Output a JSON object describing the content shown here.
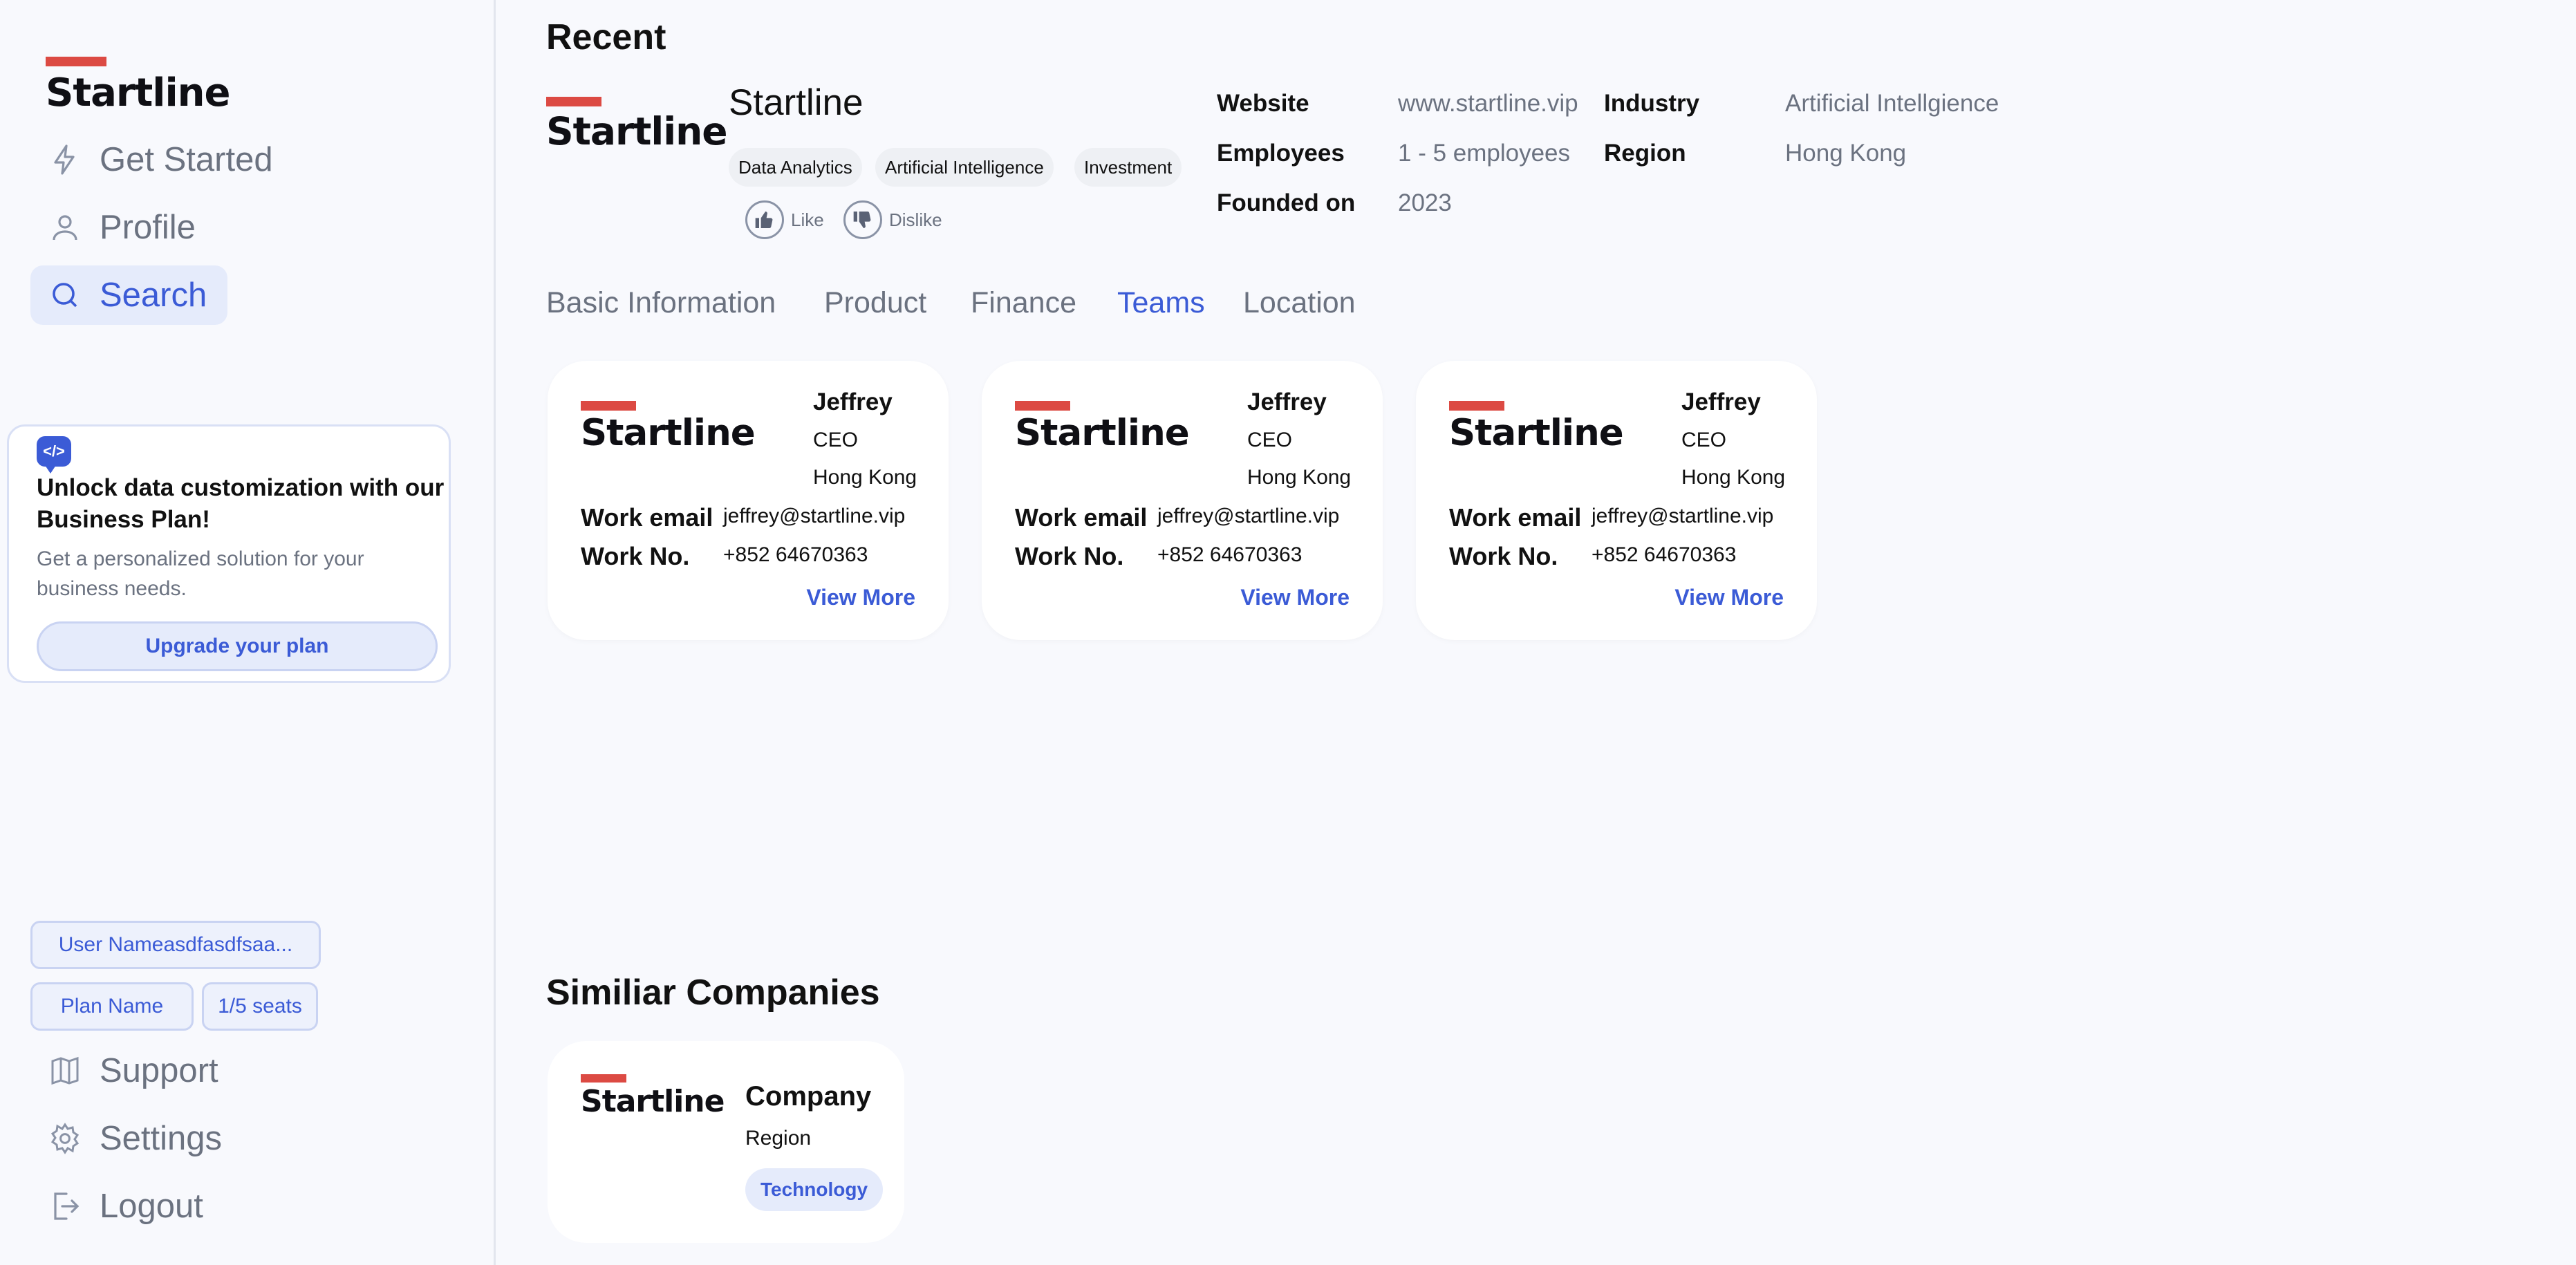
{
  "sidebar": {
    "brand": "Startline",
    "nav": [
      {
        "label": "Get Started",
        "icon": "lightning-icon"
      },
      {
        "label": "Profile",
        "icon": "person-icon"
      },
      {
        "label": "Search",
        "icon": "search-icon"
      }
    ],
    "promo": {
      "title": "Unlock data customization with our Business Plan!",
      "body": "Get a personalized solution for your business needs.",
      "button": "Upgrade your plan"
    },
    "user_name": "User Nameasdfasdfsaa...",
    "plan_name": "Plan Name",
    "seats": "1/5 seats",
    "bottom_nav": [
      {
        "label": "Support",
        "icon": "book-icon"
      },
      {
        "label": "Settings",
        "icon": "gear-icon"
      },
      {
        "label": "Logout",
        "icon": "logout-icon"
      }
    ]
  },
  "recent": {
    "heading": "Recent",
    "company": {
      "logo": "Startline",
      "name": "Startline",
      "tags": [
        "Data Analytics",
        "Artificial Intelligence",
        "Investment"
      ],
      "like": "Like",
      "dislike": "Dislike"
    },
    "info": {
      "website_label": "Website",
      "website": "www.startline.vip",
      "industry_label": "Industry",
      "industry": "Artificial Intellgience",
      "employees_label": "Employees",
      "employees": "1 - 5 employees",
      "region_label": "Region",
      "region": "Hong Kong",
      "founded_label": "Founded on",
      "founded": "2023"
    }
  },
  "tabs": [
    {
      "label": "Basic Information",
      "active": false
    },
    {
      "label": "Product",
      "active": false
    },
    {
      "label": "Finance",
      "active": false
    },
    {
      "label": "Teams",
      "active": true
    },
    {
      "label": "Location",
      "active": false
    }
  ],
  "team": [
    {
      "logo": "Startline",
      "name": "Jeffrey",
      "role": "CEO",
      "city": "Hong Kong",
      "email_label": "Work email",
      "email": "jeffrey@startline.vip",
      "phone_label": "Work No.",
      "phone": "+852 64670363",
      "more": "View More"
    },
    {
      "logo": "Startline",
      "name": "Jeffrey",
      "role": "CEO",
      "city": "Hong Kong",
      "email_label": "Work email",
      "email": "jeffrey@startline.vip",
      "phone_label": "Work No.",
      "phone": "+852 64670363",
      "more": "View More"
    },
    {
      "logo": "Startline",
      "name": "Jeffrey",
      "role": "CEO",
      "city": "Hong Kong",
      "email_label": "Work email",
      "email": "jeffrey@startline.vip",
      "phone_label": "Work No.",
      "phone": "+852 64670363",
      "more": "View More"
    }
  ],
  "similar": {
    "heading": "Similiar Companies",
    "items": [
      {
        "logo": "Startline",
        "name": "Company",
        "region": "Region",
        "tag": "Technology"
      }
    ]
  },
  "colors": {
    "accent": "#3b5bd6",
    "brand_red": "#dc4a43",
    "muted": "#6b7280"
  }
}
